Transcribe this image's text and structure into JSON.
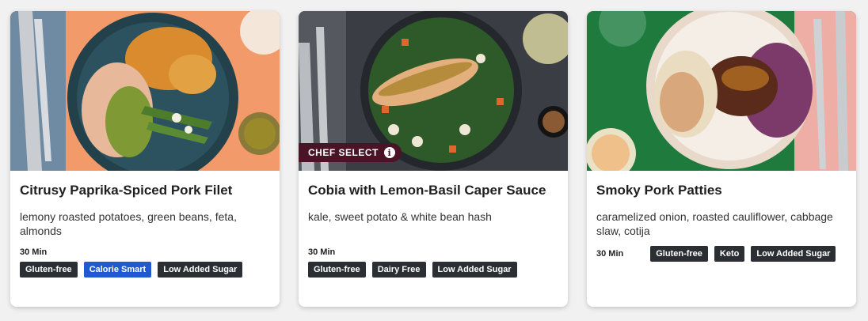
{
  "cards": [
    {
      "title": "Citrusy Paprika-Spiced Pork Filet",
      "description": "lemony roasted potatoes, green beans, feta, almonds",
      "time": "30 Min",
      "tags": [
        "Gluten-free",
        "Calorie Smart",
        "Low Added Sugar"
      ],
      "image_alt": "pork-filet-dish-photo"
    },
    {
      "title": "Cobia with Lemon-Basil Caper Sauce",
      "description": "kale, sweet potato & white bean hash",
      "time": "30 Min",
      "tags": [
        "Gluten-free",
        "Dairy Free",
        "Low Added Sugar"
      ],
      "badge": "CHEF SELECT",
      "badge_icon": "i",
      "image_alt": "cobia-dish-photo"
    },
    {
      "title": "Smoky Pork Patties",
      "description": "caramelized onion, roasted cauliflower, cabbage slaw, cotija",
      "time": "30 Min",
      "tags": [
        "Gluten-free",
        "Keto",
        "Low Added Sugar"
      ],
      "image_alt": "pork-patties-dish-photo"
    }
  ],
  "colors": {
    "tag_dark": "#2b2f33",
    "tag_blue": "#1f5ad0",
    "badge": "#4b1426"
  }
}
